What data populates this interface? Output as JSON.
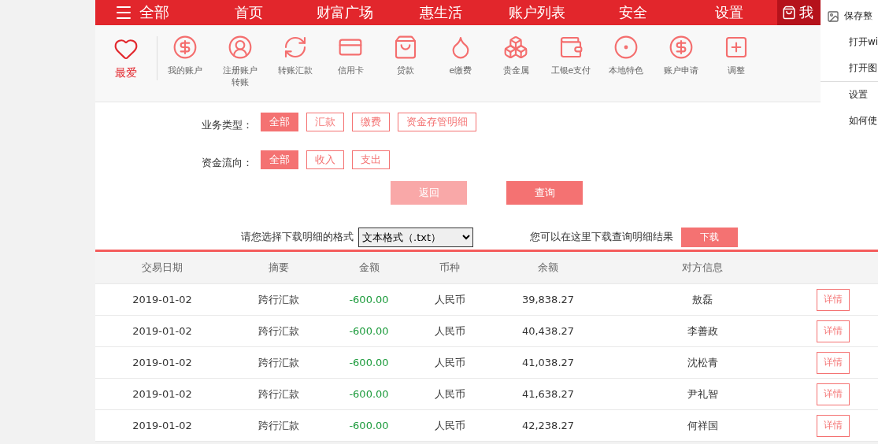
{
  "nav": {
    "menu_label": "全部",
    "items": [
      {
        "label": "首页"
      },
      {
        "label": "财富广场"
      },
      {
        "label": "惠生活"
      },
      {
        "label": "账户列表"
      },
      {
        "label": "安全"
      },
      {
        "label": "设置"
      }
    ],
    "user_label": "我"
  },
  "shortcuts": {
    "favorite": "最爱",
    "items": [
      {
        "label": "我的账户",
        "kind": "yen"
      },
      {
        "label": "注册账户转账",
        "kind": "person"
      },
      {
        "label": "转账汇款",
        "kind": "transfer"
      },
      {
        "label": "信用卡",
        "kind": "card"
      },
      {
        "label": "贷款",
        "kind": "bag"
      },
      {
        "label": "e缴费",
        "kind": "drop"
      },
      {
        "label": "贵金属",
        "kind": "bars"
      },
      {
        "label": "工银e支付",
        "kind": "pay"
      },
      {
        "label": "本地特色",
        "kind": "dots"
      },
      {
        "label": "账户申请",
        "kind": "yen"
      },
      {
        "label": "调整",
        "kind": "plus"
      }
    ]
  },
  "filters": [
    {
      "label": "业务类型：",
      "options": [
        {
          "label": "全部",
          "selected": true
        },
        {
          "label": "汇款",
          "selected": false
        },
        {
          "label": "缴费",
          "selected": false
        },
        {
          "label": "资金存管明细",
          "selected": false
        }
      ]
    },
    {
      "label": "资金流向：",
      "options": [
        {
          "label": "全部",
          "selected": true
        },
        {
          "label": "收入",
          "selected": false
        },
        {
          "label": "支出",
          "selected": false
        }
      ]
    }
  ],
  "actions": [
    {
      "label": "返回",
      "kind": "secondary"
    },
    {
      "label": "查询",
      "kind": "primary"
    }
  ],
  "download": {
    "prompt": "请您选择下载明细的格式",
    "format": "文本格式（.txt）",
    "hint": "您可以在这里下载查询明细结果",
    "button": "下载"
  },
  "table": {
    "columns": [
      "交易日期",
      "摘要",
      "金额",
      "币种",
      "余额",
      "对方信息"
    ],
    "rows": [
      {
        "date": "2019-01-02",
        "summary": "跨行汇款",
        "amount": "-600.00",
        "currency": "人民币",
        "balance": "39,838.27",
        "counterparty": "敖磊",
        "action": "详情"
      },
      {
        "date": "2019-01-02",
        "summary": "跨行汇款",
        "amount": "-600.00",
        "currency": "人民币",
        "balance": "40,438.27",
        "counterparty": "李善政",
        "action": "详情"
      },
      {
        "date": "2019-01-02",
        "summary": "跨行汇款",
        "amount": "-600.00",
        "currency": "人民币",
        "balance": "41,038.27",
        "counterparty": "沈松青",
        "action": "详情"
      },
      {
        "date": "2019-01-02",
        "summary": "跨行汇款",
        "amount": "-600.00",
        "currency": "人民币",
        "balance": "41,638.27",
        "counterparty": "尹礼智",
        "action": "详情"
      },
      {
        "date": "2019-01-02",
        "summary": "跨行汇款",
        "amount": "-600.00",
        "currency": "人民币",
        "balance": "42,238.27",
        "counterparty": "何祥国",
        "action": "详情"
      }
    ]
  },
  "context_menu": [
    {
      "label": "保存整",
      "kind": "icon"
    },
    {
      "label": "打开wi",
      "kind": "plain"
    },
    {
      "label": "打开图",
      "kind": "plain"
    },
    {
      "label": "设置",
      "kind": "separated"
    },
    {
      "label": "如何使",
      "kind": "plain"
    }
  ]
}
